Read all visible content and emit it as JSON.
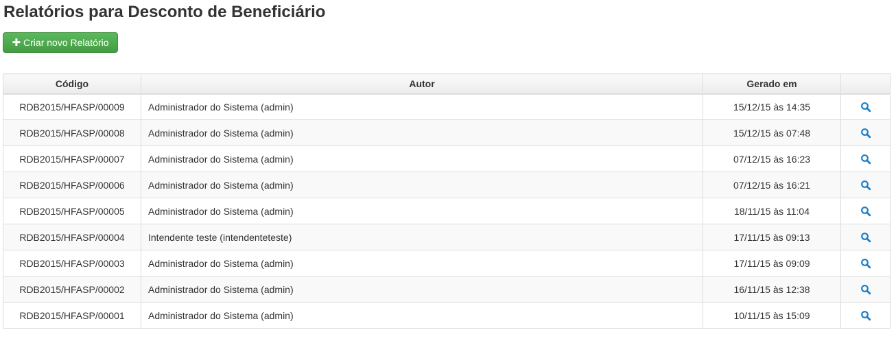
{
  "page": {
    "title": "Relatórios para Desconto de Beneficiário"
  },
  "toolbar": {
    "create_label": "Criar novo Relatório",
    "create_icon": "plus-icon",
    "button_color": "#5cb85c"
  },
  "table": {
    "headers": {
      "code": "Código",
      "author": "Autor",
      "generated_at": "Gerado em",
      "action": ""
    },
    "action_icon": "search-icon",
    "action_color": "#1a7fc7",
    "rows": [
      {
        "code": "RDB2015/HFASP/00009",
        "author": "Administrador do Sistema (admin)",
        "generated_at": "15/12/15 às 14:35"
      },
      {
        "code": "RDB2015/HFASP/00008",
        "author": "Administrador do Sistema (admin)",
        "generated_at": "15/12/15 às 07:48"
      },
      {
        "code": "RDB2015/HFASP/00007",
        "author": "Administrador do Sistema (admin)",
        "generated_at": "07/12/15 às 16:23"
      },
      {
        "code": "RDB2015/HFASP/00006",
        "author": "Administrador do Sistema (admin)",
        "generated_at": "07/12/15 às 16:21"
      },
      {
        "code": "RDB2015/HFASP/00005",
        "author": "Administrador do Sistema (admin)",
        "generated_at": "18/11/15 às 11:04"
      },
      {
        "code": "RDB2015/HFASP/00004",
        "author": "Intendente teste (intendenteteste)",
        "generated_at": "17/11/15 às 09:13"
      },
      {
        "code": "RDB2015/HFASP/00003",
        "author": "Administrador do Sistema (admin)",
        "generated_at": "17/11/15 às 09:09"
      },
      {
        "code": "RDB2015/HFASP/00002",
        "author": "Administrador do Sistema (admin)",
        "generated_at": "16/11/15 às 12:38"
      },
      {
        "code": "RDB2015/HFASP/00001",
        "author": "Administrador do Sistema (admin)",
        "generated_at": "10/11/15 às 15:09"
      }
    ]
  }
}
